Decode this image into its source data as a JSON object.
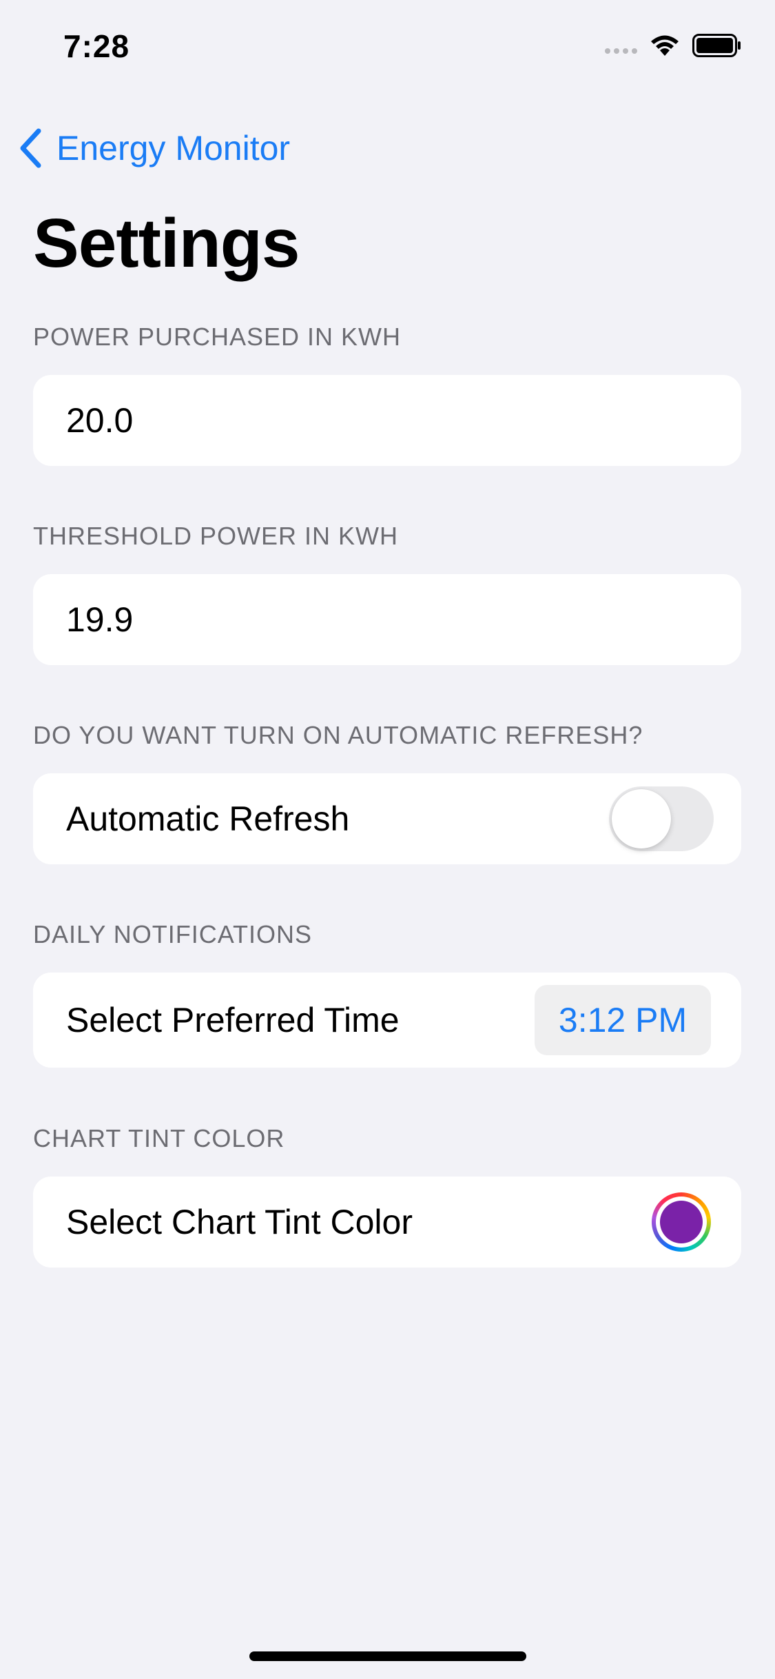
{
  "status_bar": {
    "time": "7:28",
    "icons": [
      "cellular-signal-icon",
      "wifi-icon",
      "battery-icon"
    ]
  },
  "nav": {
    "back_label": "Energy Monitor"
  },
  "title": "Settings",
  "sections": {
    "power_purchased": {
      "header": "POWER PURCHASED IN KWH",
      "value": "20.0"
    },
    "threshold_power": {
      "header": "THRESHOLD POWER IN KWH",
      "value": "19.9"
    },
    "automatic_refresh": {
      "header": "DO YOU WANT TURN ON AUTOMATIC REFRESH?",
      "label": "Automatic Refresh",
      "enabled": false
    },
    "daily_notifications": {
      "header": "DAILY NOTIFICATIONS",
      "label": "Select Preferred Time",
      "time": "3:12 PM"
    },
    "chart_tint": {
      "header": "CHART TINT COLOR",
      "label": "Select Chart Tint Color",
      "color": "#7a22a8"
    }
  },
  "colors": {
    "accent": "#1a7cf5",
    "background": "#f2f2f7",
    "section_header": "#6c6c72"
  }
}
